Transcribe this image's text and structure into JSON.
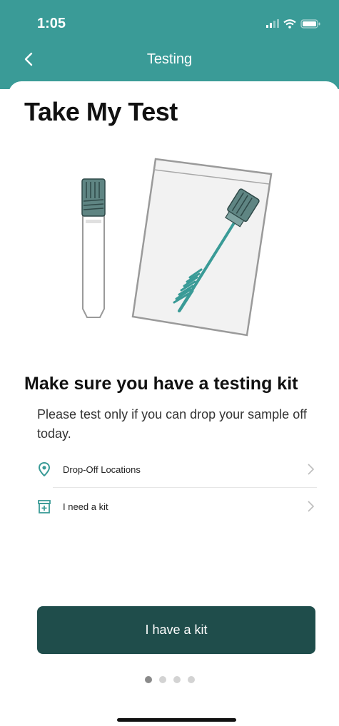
{
  "status_bar": {
    "time": "1:05"
  },
  "header": {
    "title": "Testing"
  },
  "page": {
    "title": "Take My Test"
  },
  "section": {
    "title": "Make sure you have a testing kit",
    "description": "Please test only if you can drop your sample off today."
  },
  "list": [
    {
      "label": "Drop-Off Locations",
      "icon": "location-pin-icon"
    },
    {
      "label": "I need a kit",
      "icon": "medical-kit-icon"
    }
  ],
  "primary_button": {
    "label": "I have a kit"
  },
  "pagination": {
    "total": 4,
    "current": 1
  },
  "colors": {
    "header": "#3a9b97",
    "button": "#1f4d4b",
    "accent": "#3a9b97"
  }
}
